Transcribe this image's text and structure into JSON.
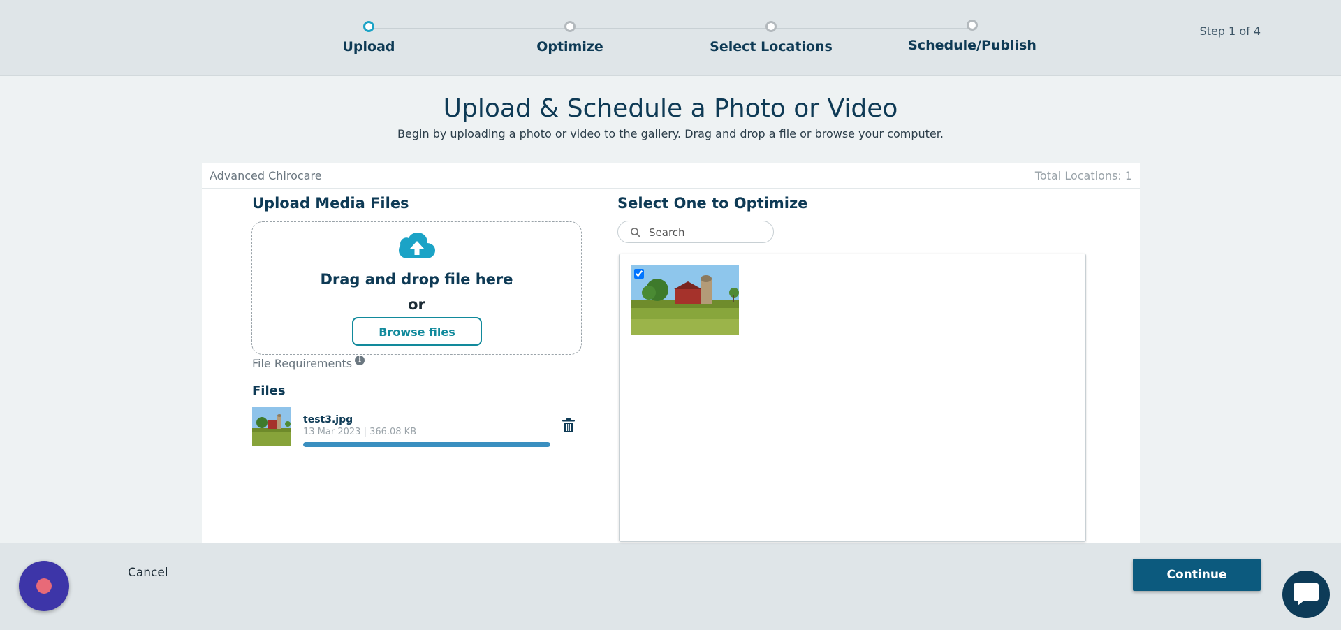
{
  "stepper": {
    "steps": [
      {
        "label": "Upload",
        "active": true
      },
      {
        "label": "Optimize",
        "active": false
      },
      {
        "label": "Select Locations",
        "active": false
      },
      {
        "label": "Schedule/Publish",
        "active": false
      }
    ],
    "step_count": "Step 1 of 4"
  },
  "page": {
    "title": "Upload & Schedule a Photo or Video",
    "subtitle": "Begin by uploading a photo or video to the gallery. Drag and drop a file or browse your computer."
  },
  "card": {
    "location_name": "Advanced Chirocare",
    "total_locations": "Total Locations: 1"
  },
  "upload": {
    "title": "Upload Media Files",
    "dropzone_title": "Drag and drop file here",
    "or_text": "or",
    "browse_label": "Browse files",
    "file_requirements": "File Requirements",
    "files_title": "Files",
    "files": [
      {
        "name": "test3.jpg",
        "meta": "13 Mar 2023 |  366.08 KB",
        "progress": 1.0
      }
    ]
  },
  "optimize": {
    "title": "Select One to Optimize",
    "search_placeholder": "Search",
    "selected": true
  },
  "footer": {
    "cancel_label": "Cancel",
    "continue_label": "Continue"
  },
  "colors": {
    "accent": "#1ba3c6",
    "primary": "#0c5a7e",
    "heading": "#0e3a55",
    "progress": "#3a8fc0"
  },
  "icons": [
    "cloud-upload-icon",
    "info-icon",
    "trash-icon",
    "search-icon",
    "chat-icon",
    "record-icon"
  ]
}
